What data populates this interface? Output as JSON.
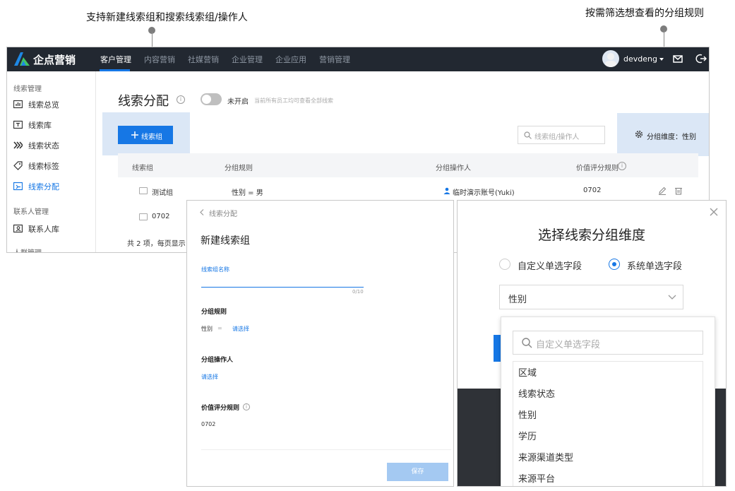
{
  "annotations": {
    "left": "支持新建线索组和搜索线索组/操作人",
    "right": "按需筛选想查看的分组规则"
  },
  "app": {
    "brand": "企点营销",
    "nav": [
      "客户管理",
      "内容营销",
      "社媒营销",
      "企业管理",
      "企业应用",
      "营销管理"
    ],
    "active_nav": "客户管理",
    "username": "devdeng",
    "icons": [
      "mail-icon",
      "logout-icon",
      "caret-down-icon"
    ]
  },
  "sidebar": {
    "group1": "线索管理",
    "items": [
      "线索总览",
      "线索库",
      "线索状态",
      "线索标签",
      "线索分配"
    ],
    "active": "线索分配",
    "group2": "联系人管理",
    "items2": [
      "联系人库"
    ],
    "group3": "人群管理"
  },
  "content": {
    "title": "线索分配",
    "toggle_label": "未开启",
    "toggle_hint": "当前所有员工均可查看全部线索",
    "add_button": "线索组",
    "search_placeholder": "线索组/操作人",
    "dimension_label": "分组维度：性别",
    "columns": [
      "线索组",
      "分组规则",
      "分组操作人",
      "价值评分规则"
    ],
    "rows": [
      {
        "name": "测试组",
        "rule": "性别 = 男",
        "operator": "临时演示账号(Yuki)",
        "score": "0702"
      },
      {
        "name": "0702",
        "rule": "",
        "operator": "",
        "score": ""
      }
    ],
    "footer": "共 2 项，每页显示"
  },
  "dialog_new": {
    "back": "线索分配",
    "title": "新建线索组",
    "name_label": "线索组名称",
    "name_counter": "0/10",
    "rule_label": "分组规则",
    "rule_field": "性别",
    "rule_op": "=",
    "rule_select": "请选择",
    "operator_label": "分组操作人",
    "operator_select": "请选择",
    "score_label": "价值评分规则",
    "score_value": "0702",
    "save": "保存"
  },
  "dialog_dim": {
    "title": "选择线索分组维度",
    "radio1": "自定义单选字段",
    "radio2": "系统单选字段",
    "selected_radio": "系统单选字段",
    "select_value": "性别",
    "search_placeholder": "自定义单选字段",
    "options": [
      "区域",
      "线索状态",
      "性别",
      "学历",
      "来源渠道类型",
      "来源平台"
    ]
  },
  "colors": {
    "primary": "#1677e5",
    "topbar": "#222831",
    "highlight": "#dbe7f6",
    "save_disabled": "#a4c9f2"
  }
}
